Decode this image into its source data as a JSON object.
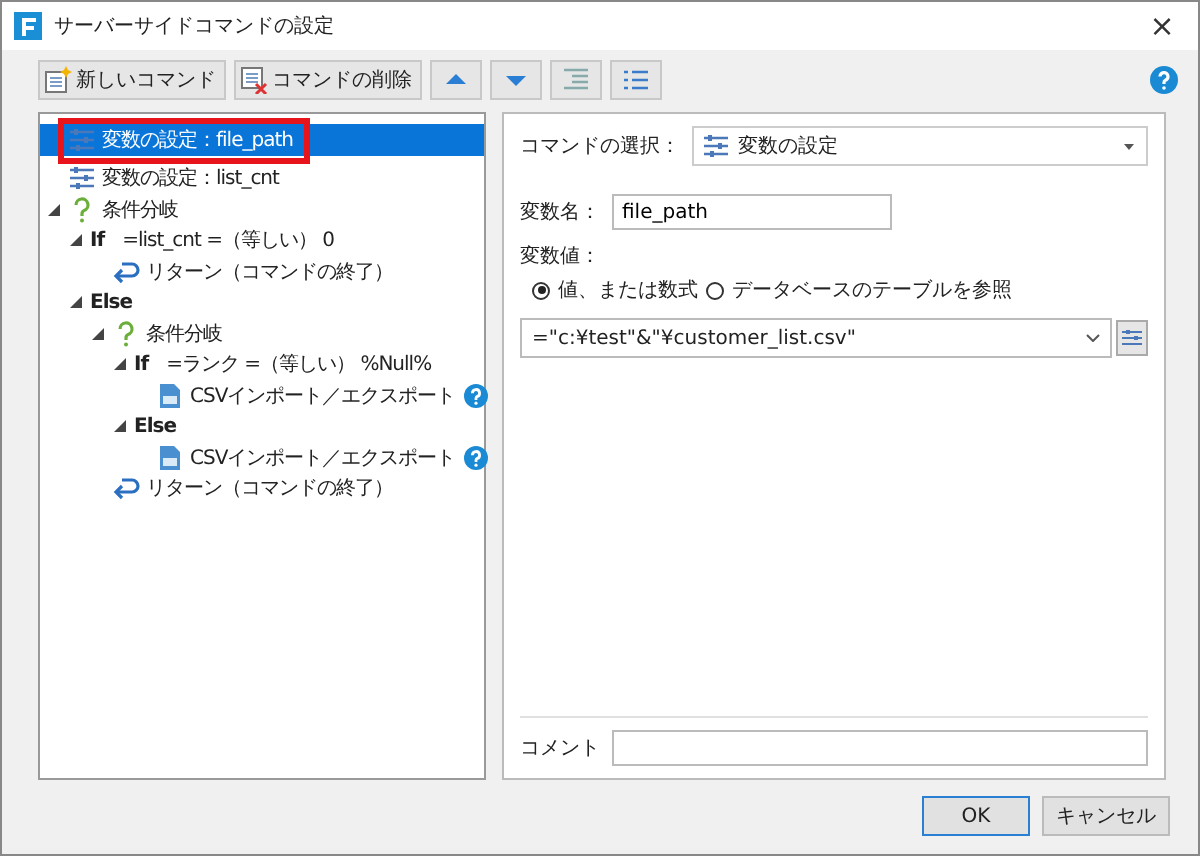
{
  "window": {
    "title": "サーバーサイドコマンドの設定",
    "close": "×"
  },
  "toolbar": {
    "buttons": [
      {
        "kind": "new",
        "label": "新しいコマンド"
      },
      {
        "kind": "delete",
        "label": "コマンドの削除"
      },
      {
        "kind": "up"
      },
      {
        "kind": "down"
      },
      {
        "kind": "indent"
      },
      {
        "kind": "outdent"
      }
    ]
  },
  "tree": [
    {
      "kind": "variable",
      "label": "変数の設定：file_path",
      "selected": true,
      "outlined": true
    },
    {
      "kind": "variable",
      "label": "変数の設定：list_cnt",
      "selected": false
    },
    {
      "kind": "condition",
      "label": "条件分岐",
      "selected": false,
      "expanded": true,
      "children": [
        {
          "kind": "branch",
          "keyword": "If",
          "label": "=list_cnt =（等しい） 0",
          "selected": false,
          "expanded": true,
          "children": [
            {
              "kind": "return",
              "label": "リターン（コマンドの終了）",
              "selected": false
            }
          ]
        },
        {
          "kind": "branch",
          "keyword": "Else",
          "selected": false,
          "expanded": true,
          "children": [
            {
              "kind": "condition",
              "label": "条件分岐",
              "selected": false,
              "expanded": true,
              "children": [
                {
                  "kind": "branch",
                  "keyword": "If",
                  "label": "=ランク =（等しい） %Null%",
                  "selected": false,
                  "expanded": true,
                  "children": [
                    {
                      "kind": "csv",
                      "label": "CSVインポート／エクスポート",
                      "selected": false,
                      "help": true
                    }
                  ]
                },
                {
                  "kind": "branch",
                  "keyword": "Else",
                  "selected": false,
                  "expanded": true,
                  "children": [
                    {
                      "kind": "csv",
                      "label": "CSVインポート／エクスポート",
                      "selected": false,
                      "help": true
                    }
                  ]
                }
              ]
            },
            {
              "kind": "return",
              "label": "リターン（コマンドの終了）",
              "selected": false
            }
          ]
        }
      ]
    }
  ],
  "detail": {
    "command_label": "コマンドの選択：",
    "command_value": "変数の設定",
    "name_label": "変数名：",
    "name_value": "file_path",
    "value_label": "変数値：",
    "radios": [
      {
        "label": "値、または数式",
        "selected": true
      },
      {
        "label": "データベースのテーブルを参照",
        "selected": false
      }
    ],
    "expression": "=\"c:¥test\"&\"¥customer_list.csv\"",
    "comment_label": "コメント"
  },
  "buttons": [
    {
      "label": "OK",
      "default": true
    },
    {
      "label": "キャンセル",
      "default": false
    }
  ]
}
